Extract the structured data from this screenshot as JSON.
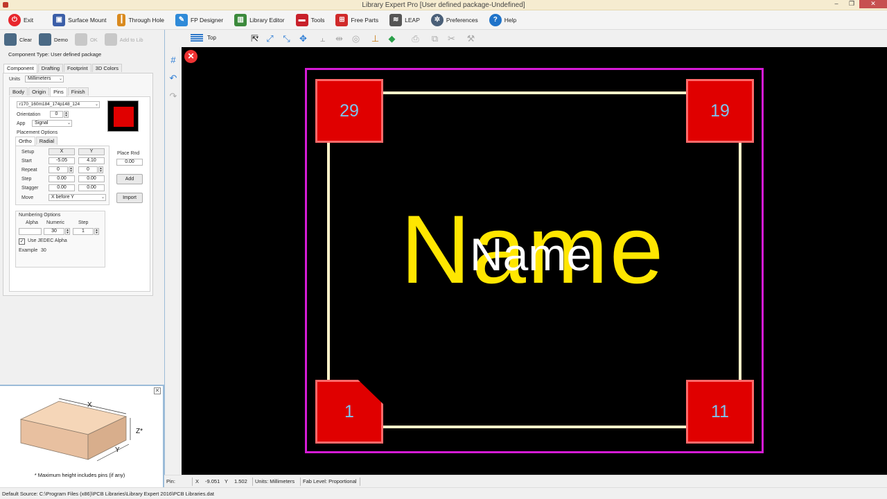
{
  "window": {
    "title": "Library Expert Pro [User defined package-Undefined]"
  },
  "main_toolbar": {
    "items": [
      {
        "label": "Exit",
        "icon": "power-icon",
        "color": "#e8262c"
      },
      {
        "label": "Surface Mount",
        "icon": "chip-icon",
        "color": "#3b5ea8"
      },
      {
        "label": "Through Hole",
        "icon": "through-hole-icon",
        "color": "#d98a1f"
      },
      {
        "label": "FP Designer",
        "icon": "fp-designer-icon",
        "color": "#2f8ad8"
      },
      {
        "label": "Library Editor",
        "icon": "books-icon",
        "color": "#3c8a3c"
      },
      {
        "label": "Tools",
        "icon": "toolbox-icon",
        "color": "#c8202a"
      },
      {
        "label": "Free Parts",
        "icon": "cart-icon",
        "color": "#d02a2a"
      },
      {
        "label": "LEAP",
        "icon": "database-icon",
        "color": "#555555"
      },
      {
        "label": "Preferences",
        "icon": "gear-icon",
        "color": "#4a5f78"
      },
      {
        "label": "Help",
        "icon": "help-icon",
        "color": "#1f73c9"
      }
    ]
  },
  "left_panel": {
    "toolbar": {
      "clear": "Clear",
      "demo": "Demo",
      "ok": "OK",
      "add_to_lib": "Add to Lib"
    },
    "component_type": "Component Type: User defined package",
    "tabs": [
      "Component",
      "Drafting",
      "Footprint",
      "3D Colors"
    ],
    "units_label": "Units",
    "units_value": "Millimeters",
    "sub_tabs": [
      "Body",
      "Origin",
      "Pins",
      "Finish"
    ],
    "pin_name": "r170_160m184_174p148_124",
    "orientation_label": "Orientation",
    "orientation_value": "0",
    "app_label": "App",
    "app_value": "Signal",
    "placement_options": "Placement Options",
    "placement_tabs": [
      "Ortho",
      "Radial"
    ],
    "col_x": "X",
    "col_y": "Y",
    "setup": "Setup",
    "place_rnd_label": "Place Rnd",
    "place_rnd_value": "0.00",
    "rows": {
      "start": {
        "label": "Start",
        "x": "-5.05",
        "y": "4.10"
      },
      "repeat": {
        "label": "Repeat",
        "x": "0",
        "y": "0"
      },
      "step": {
        "label": "Step",
        "x": "0.00",
        "y": "0.00"
      },
      "stagger": {
        "label": "Stagger",
        "x": "0.00",
        "y": "0.00"
      }
    },
    "move_label": "Move",
    "move_value": "X before Y",
    "add_button": "Add",
    "import_button": "Import",
    "numbering_options": "Numbering Options",
    "alpha_label": "Alpha",
    "numeric_label": "Numeric",
    "step_label": "Step",
    "alpha_value": "",
    "numeric_value": "30",
    "step_value": "1",
    "jedec_label": "Use JEDEC Alpha",
    "jedec_checked": true,
    "example_label": "Example",
    "example_value": "30"
  },
  "preview": {
    "dim_x": "X",
    "dim_y": "Y",
    "dim_z": "Z*",
    "note": "* Maximum height includes pins (if any)"
  },
  "canvas_toolbar": {
    "layer": "Top"
  },
  "canvas": {
    "pads": [
      {
        "label": "29"
      },
      {
        "label": "19"
      },
      {
        "label": "1"
      },
      {
        "label": "11"
      }
    ],
    "name_large": "Name",
    "name_small": "Name",
    "colors": {
      "outline": "#d61bd6",
      "pad": "#e00000",
      "silk": "#fff3c9",
      "name_large": "#ffe600"
    }
  },
  "status": {
    "pin_label": "Pin:",
    "x_label": "X",
    "x_value": "-9.051",
    "y_label": "Y",
    "y_value": "1.502",
    "units": "Units: Millimeters",
    "fab_level": "Fab Level: Proportional"
  },
  "footer": {
    "default_source": "Default Source:  C:\\Program Files (x86)\\PCB Libraries\\Library Expert 2016\\PCB Libraries.dat"
  }
}
